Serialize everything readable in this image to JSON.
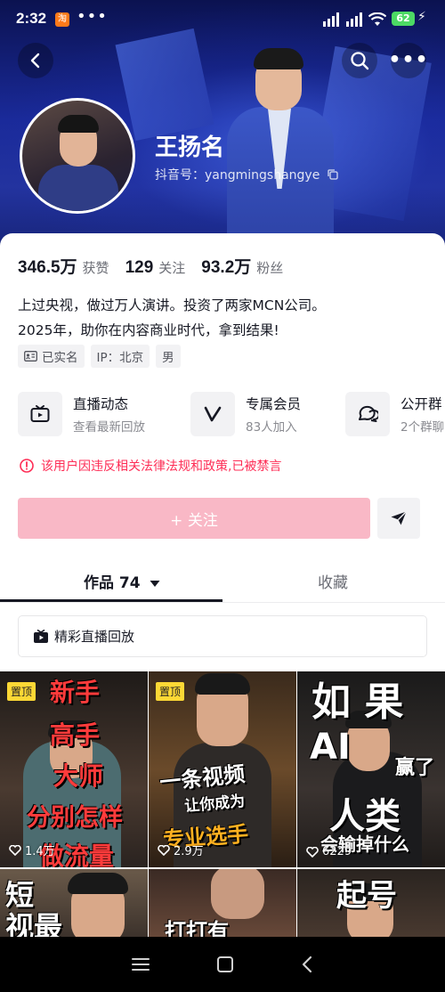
{
  "status_bar": {
    "time": "2:32",
    "app_badge": "淘",
    "battery": "62"
  },
  "profile": {
    "name": "王扬名",
    "douyin_id": "抖音号：yangmingshangye"
  },
  "stats": [
    {
      "value": "346.5万",
      "label": "获赞"
    },
    {
      "value": "129",
      "label": "关注"
    },
    {
      "value": "93.2万",
      "label": "粉丝"
    }
  ],
  "bio": {
    "line1": "上过央视，做过万人演讲。投资了两家MCN公司。",
    "line2": "2025年，助你在内容商业时代，拿到结果!"
  },
  "tags": {
    "verified": "已实名",
    "ip": "IP：北京",
    "gender": "男"
  },
  "features": [
    {
      "title": "直播动态",
      "sub": "查看最新回放",
      "icon": "tv-icon"
    },
    {
      "title": "专属会员",
      "sub": "83人加入",
      "icon": "v-icon"
    },
    {
      "title": "公开群",
      "sub": "2个群聊",
      "icon": "chat-icon"
    }
  ],
  "warning": "该用户因违反相关法律法规和政策,已被禁言",
  "follow_label": "+ 关注",
  "tabs": {
    "works": "作品 74",
    "collect": "收藏"
  },
  "live_replay": "精彩直播回放",
  "videos": [
    {
      "pinned": "置顶",
      "likes": "1.4万",
      "caption": [
        "新手",
        "高手",
        "大师",
        "分别怎样",
        "做流量"
      ]
    },
    {
      "pinned": "置顶",
      "likes": "2.9万",
      "caption": [
        "一条视频",
        "让你成为",
        "专业选手"
      ]
    },
    {
      "pinned": "",
      "likes": "6229",
      "caption": [
        "如 果",
        "AI",
        "赢了",
        "人类",
        "会输掉什么"
      ]
    },
    {
      "pinned": "",
      "likes": "",
      "caption": [
        "短",
        "视最"
      ]
    },
    {
      "pinned": "",
      "likes": "",
      "caption": [
        "打打有"
      ]
    },
    {
      "pinned": "",
      "likes": "",
      "caption": [
        "起号"
      ]
    }
  ],
  "colors": {
    "accent": "#fe2c55",
    "follow_disabled": "#f9b8c6",
    "pin": "#fdd835"
  }
}
